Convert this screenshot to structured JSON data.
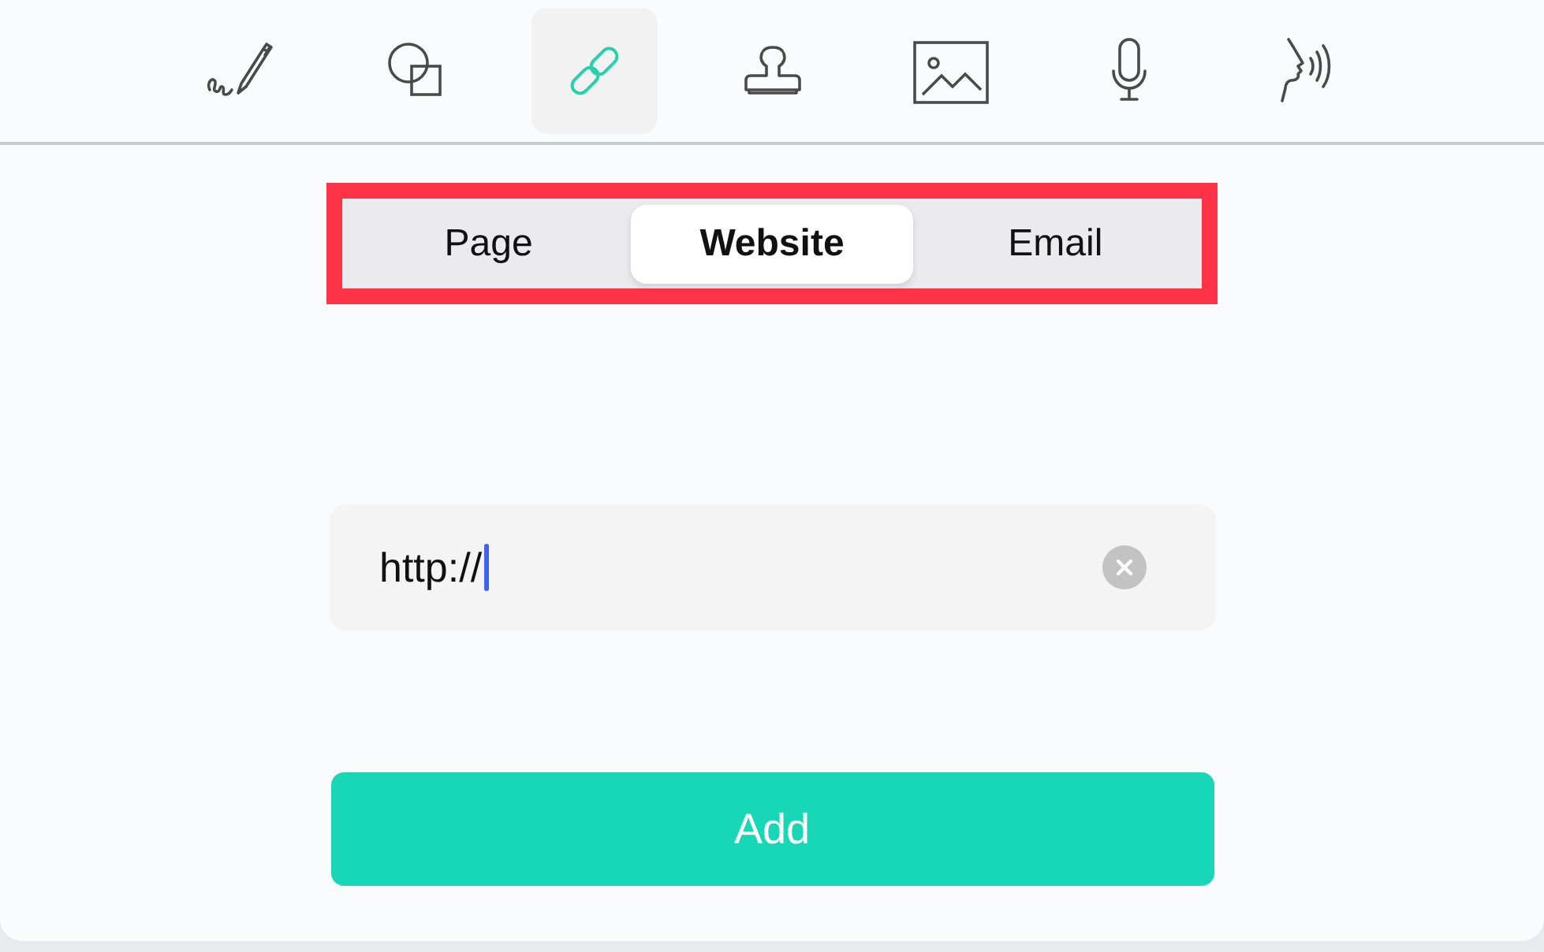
{
  "toolbar": {
    "tools": [
      {
        "kind": "signature",
        "selected": false
      },
      {
        "kind": "shapes",
        "selected": false
      },
      {
        "kind": "link",
        "selected": true
      },
      {
        "kind": "stamp",
        "selected": false
      },
      {
        "kind": "image",
        "selected": false
      },
      {
        "kind": "audio",
        "selected": false
      },
      {
        "kind": "speech",
        "selected": false
      }
    ]
  },
  "link_type": {
    "highlighted": true,
    "segments": [
      {
        "label": "Page",
        "selected": false
      },
      {
        "label": "Website",
        "selected": true
      },
      {
        "label": "Email",
        "selected": false
      }
    ]
  },
  "url_field": {
    "value": "http://"
  },
  "add_button": {
    "label": "Add"
  }
}
